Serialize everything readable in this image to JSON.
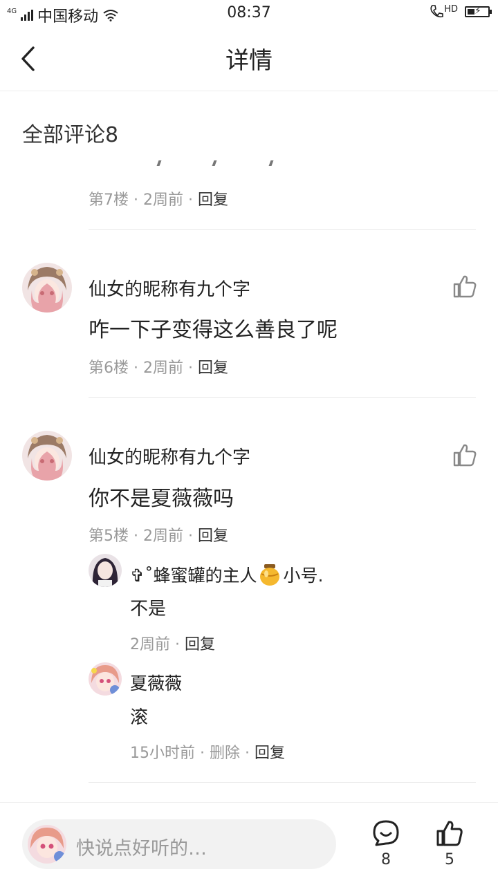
{
  "status_bar": {
    "network": "4G",
    "carrier": "中国移动",
    "time": "08:37",
    "hd": "HD"
  },
  "header": {
    "title": "详情"
  },
  "comments_section": {
    "title": "全部评论8"
  },
  "floor7": {
    "floor": "第7楼",
    "time": "2周前",
    "reply": "回复"
  },
  "floor6": {
    "username": "仙女的昵称有九个字",
    "content": "咋一下子变得这么善良了呢",
    "floor": "第6楼",
    "time": "2周前",
    "reply": "回复"
  },
  "floor5": {
    "username": "仙女的昵称有九个字",
    "content": "你不是夏薇薇吗",
    "floor": "第5楼",
    "time": "2周前",
    "reply": "回复",
    "replies": [
      {
        "name": "✞˚蜂蜜罐的主人",
        "name_suffix": "小号.",
        "emoji": "🍯",
        "content": "不是",
        "time": "2周前",
        "reply": "回复"
      },
      {
        "name": "夏薇薇",
        "content": "滚",
        "time": "15小时前",
        "delete": "删除",
        "reply": "回复"
      }
    ]
  },
  "bottom_bar": {
    "placeholder": "快说点好听的…",
    "comment_count": "8",
    "like_count": "5"
  },
  "colors": {
    "text": "#222222",
    "meta": "#999999",
    "divider": "#e8e8e8",
    "input_bg": "#f2f2f2"
  }
}
